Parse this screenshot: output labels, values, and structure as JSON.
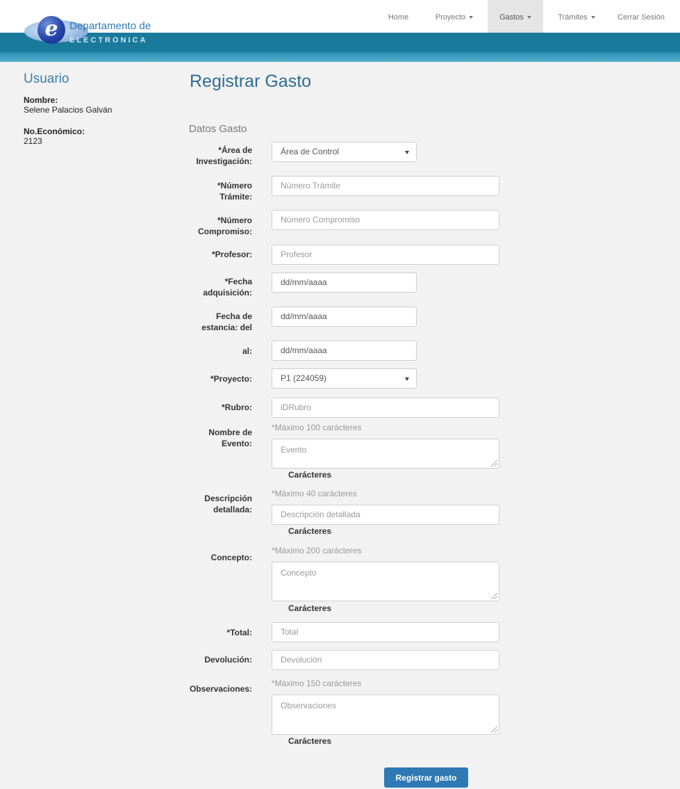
{
  "header": {
    "logo_letter": "e",
    "logo_line1": "Departamento de",
    "logo_line2": "ELECTRONICA",
    "nav": [
      {
        "label": "Home",
        "dropdown": false,
        "active": false
      },
      {
        "label": "Proyecto",
        "dropdown": true,
        "active": false
      },
      {
        "label": "Gastos",
        "dropdown": true,
        "active": true
      },
      {
        "label": "Trámites",
        "dropdown": true,
        "active": false
      },
      {
        "label": "Cerrar Sesión",
        "dropdown": false,
        "active": false
      }
    ]
  },
  "sidebar": {
    "title": "Usuario",
    "name_label": "Nombre:",
    "name_value": "Selene Palacios Galván",
    "econ_label": "No.Económico:",
    "econ_value": "2123"
  },
  "form": {
    "title": "Registrar Gasto",
    "section": "Datos Gasto",
    "area": {
      "label": "*Área de Investigación:",
      "value": "Área de Control"
    },
    "numero_tramite": {
      "label": "*Número Trámite:",
      "placeholder": "Número Trámite"
    },
    "numero_compromiso": {
      "label": "*Número Compromiso:",
      "placeholder": "Número Compromiso"
    },
    "profesor": {
      "label": "*Profesor:",
      "placeholder": "Profesor"
    },
    "fecha_adquisicion": {
      "label": "*Fecha adquisición:",
      "value": "dd/mm/aaaa"
    },
    "fecha_estancia_del": {
      "label": "Fecha de estancia: del",
      "value": "dd/mm/aaaa"
    },
    "fecha_estancia_al": {
      "label": "al:",
      "value": "dd/mm/aaaa"
    },
    "proyecto": {
      "label": "*Proyecto:",
      "value": "P1 (224059)"
    },
    "rubro": {
      "label": "*Rubro:",
      "placeholder": "iDRubro"
    },
    "nombre_evento": {
      "label": "Nombre de Evento:",
      "hint": "*Máximo 100 carácteres",
      "placeholder": "Evento",
      "counter": "Carácteres"
    },
    "descripcion": {
      "label": "Descripción detallada:",
      "hint": "*Máximo 40 carácteres",
      "placeholder": "Descripción detallada",
      "counter": "Carácteres"
    },
    "concepto": {
      "label": "Concepto:",
      "hint": "*Máximo 200 carácteres",
      "placeholder": "Concepto",
      "counter": "Carácteres"
    },
    "total": {
      "label": "*Total:",
      "placeholder": "Total"
    },
    "devolucion": {
      "label": "Devolución:",
      "placeholder": "Devolución"
    },
    "observaciones": {
      "label": "Observaciones:",
      "hint": "*Máximo 150 carácteres",
      "placeholder": "Observaciones",
      "counter": "Carácteres"
    },
    "submit_label": "Registrar gasto"
  }
}
